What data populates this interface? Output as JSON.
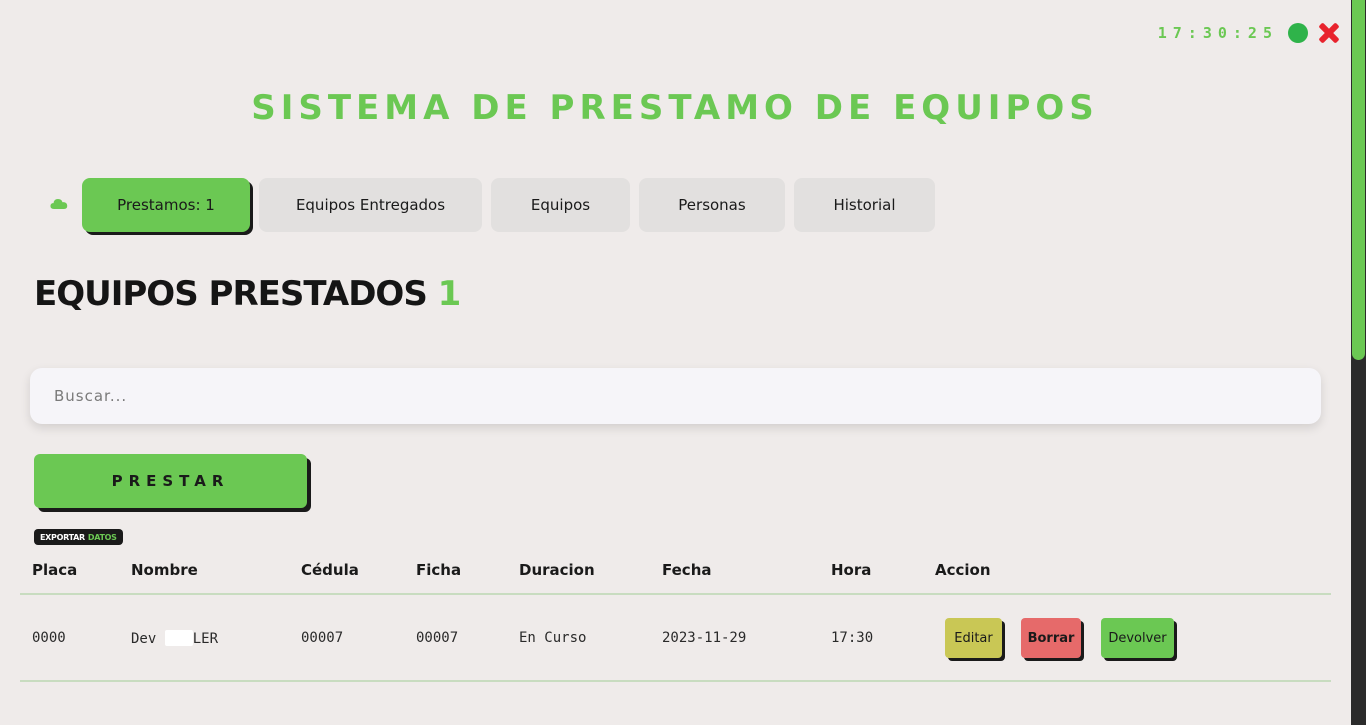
{
  "header": {
    "clock": "17:30:25",
    "title": "SISTEMA DE PRESTAMO DE EQUIPOS"
  },
  "tabs": [
    {
      "label": "Prestamos: 1",
      "active": true
    },
    {
      "label": "Equipos Entregados",
      "active": false
    },
    {
      "label": "Equipos",
      "active": false
    },
    {
      "label": "Personas",
      "active": false
    },
    {
      "label": "Historial",
      "active": false
    }
  ],
  "section": {
    "title": "EQUIPOS PRESTADOS",
    "count": "1"
  },
  "search": {
    "placeholder": "Buscar...",
    "value": ""
  },
  "actions": {
    "prestar_label": "PRESTAR",
    "export_label": "EXPORTAR",
    "export_highlight": "DATOS"
  },
  "table": {
    "columns": [
      "Placa",
      "Nombre",
      "Cédula",
      "Ficha",
      "Duracion",
      "Fecha",
      "Hora",
      "Accion"
    ],
    "rows": [
      {
        "placa": "0000",
        "nombre_prefix": "Dev",
        "nombre_suffix": "LER",
        "cedula": "00007",
        "ficha": "00007",
        "duracion": "En Curso",
        "fecha": "2023-11-29",
        "hora": "17:30",
        "edit_label": "Editar",
        "delete_label": "Borrar",
        "return_label": "Devolver"
      }
    ]
  },
  "colors": {
    "accent": "#6bc853",
    "background": "#efebea",
    "edit": "#c9c755",
    "delete": "#e66a6a",
    "return": "#6bc853",
    "close": "#e8232d",
    "status": "#2fb34a"
  },
  "icons": [
    "cloud-icon",
    "status-dot-icon",
    "close-icon"
  ]
}
